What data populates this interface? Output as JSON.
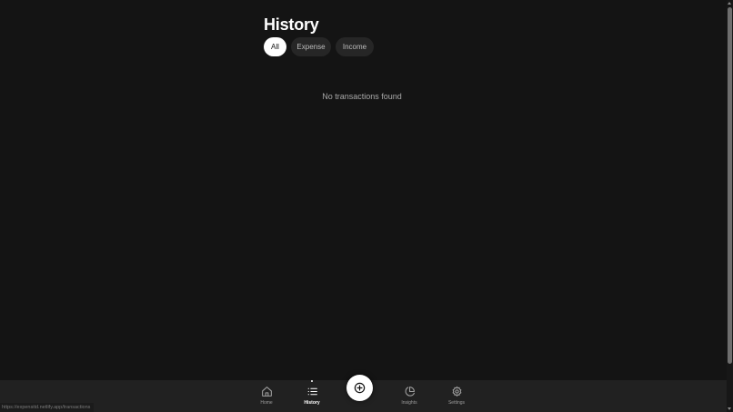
{
  "header": {
    "title": "History"
  },
  "filters": {
    "all_label": "All",
    "expense_label": "Expense",
    "income_label": "Income",
    "selected": "All"
  },
  "empty_state": {
    "message": "No transactions found"
  },
  "bottom_nav": {
    "items": [
      {
        "label": "Home",
        "icon": "home-icon",
        "active": false
      },
      {
        "label": "History",
        "icon": "list-icon",
        "active": true
      },
      {
        "label": "Insights",
        "icon": "pie-chart-icon",
        "active": false
      },
      {
        "label": "Settings",
        "icon": "gear-icon",
        "active": false
      }
    ],
    "fab_icon": "plus-circle-icon"
  },
  "status_bar": {
    "url": "https://expensitd.netlify.app/transactions"
  },
  "colors": {
    "background": "#141414",
    "nav_background": "#212121",
    "chip_background": "#262626",
    "chip_active": "#ffffff",
    "text_primary": "#ffffff",
    "text_muted": "#a8a8a8"
  }
}
